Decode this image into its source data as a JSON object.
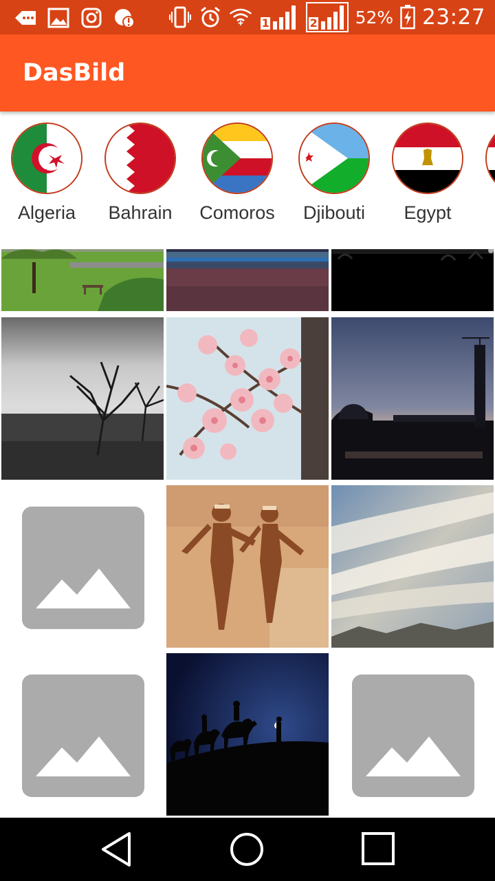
{
  "status_bar": {
    "battery": "52%",
    "time": "23:27",
    "sim1": "1",
    "sim2": "2",
    "icons": [
      "back-arrow-icon",
      "gallery-icon",
      "instagram-icon",
      "sync-alert-icon",
      "vibrate-icon",
      "alarm-icon",
      "wifi-icon",
      "signal-sim1-icon",
      "signal-sim2-icon",
      "battery-charging-icon"
    ]
  },
  "app_bar": {
    "title": "DasBild"
  },
  "countries": [
    {
      "name": "Algeria",
      "flag": "algeria-flag-icon"
    },
    {
      "name": "Bahrain",
      "flag": "bahrain-flag-icon"
    },
    {
      "name": "Comoros",
      "flag": "comoros-flag-icon"
    },
    {
      "name": "Djibouti",
      "flag": "djibouti-flag-icon"
    },
    {
      "name": "Egypt",
      "flag": "egypt-flag-icon"
    },
    {
      "name": "",
      "flag": "partial-flag-icon"
    }
  ],
  "photos": [
    {
      "kind": "park-with-bench"
    },
    {
      "kind": "sea-shore-dusk"
    },
    {
      "kind": "dark-silhouettes"
    },
    {
      "kind": "bare-tree-bw"
    },
    {
      "kind": "almond-blossom"
    },
    {
      "kind": "city-dusk-tower"
    },
    {
      "kind": "image-placeholder"
    },
    {
      "kind": "rock-art"
    },
    {
      "kind": "cloudy-sky"
    },
    {
      "kind": "image-placeholder"
    },
    {
      "kind": "camel-caravan-night"
    },
    {
      "kind": "image-placeholder"
    }
  ],
  "colors": {
    "status_bar": "#d84315",
    "app_bar": "#ff5722",
    "placeholder": "#ababab",
    "nav_bar": "#000000"
  },
  "nav_bar": {
    "buttons": [
      "back-icon",
      "home-icon",
      "recents-icon"
    ]
  }
}
